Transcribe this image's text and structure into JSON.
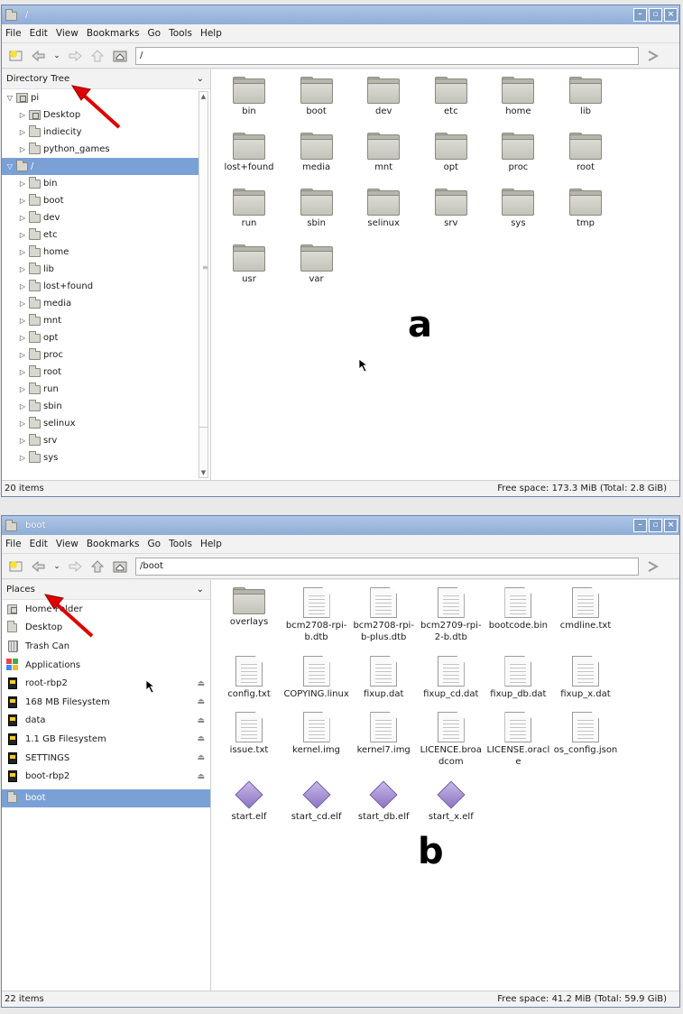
{
  "menu": [
    "File",
    "Edit",
    "View",
    "Bookmarks",
    "Go",
    "Tools",
    "Help"
  ],
  "window_a": {
    "title": "/",
    "path": "/",
    "side_title": "Directory Tree",
    "tree": [
      {
        "label": "pi",
        "level": 0,
        "open": true,
        "home": true,
        "selected": false
      },
      {
        "label": "Desktop",
        "level": 1,
        "open": false,
        "home": true,
        "selected": false
      },
      {
        "label": "indiecity",
        "level": 1,
        "open": false,
        "home": false,
        "selected": false
      },
      {
        "label": "python_games",
        "level": 1,
        "open": false,
        "home": false,
        "selected": false
      },
      {
        "label": "/",
        "level": 0,
        "open": true,
        "home": false,
        "selected": true
      },
      {
        "label": "bin",
        "level": 1,
        "open": false,
        "home": false,
        "selected": false
      },
      {
        "label": "boot",
        "level": 1,
        "open": false,
        "home": false,
        "selected": false
      },
      {
        "label": "dev",
        "level": 1,
        "open": false,
        "home": false,
        "selected": false
      },
      {
        "label": "etc",
        "level": 1,
        "open": false,
        "home": false,
        "selected": false
      },
      {
        "label": "home",
        "level": 1,
        "open": false,
        "home": false,
        "selected": false
      },
      {
        "label": "lib",
        "level": 1,
        "open": false,
        "home": false,
        "selected": false
      },
      {
        "label": "lost+found",
        "level": 1,
        "open": false,
        "home": false,
        "selected": false
      },
      {
        "label": "media",
        "level": 1,
        "open": false,
        "home": false,
        "selected": false
      },
      {
        "label": "mnt",
        "level": 1,
        "open": false,
        "home": false,
        "selected": false
      },
      {
        "label": "opt",
        "level": 1,
        "open": false,
        "home": false,
        "selected": false
      },
      {
        "label": "proc",
        "level": 1,
        "open": false,
        "home": false,
        "selected": false
      },
      {
        "label": "root",
        "level": 1,
        "open": false,
        "home": false,
        "selected": false
      },
      {
        "label": "run",
        "level": 1,
        "open": false,
        "home": false,
        "selected": false
      },
      {
        "label": "sbin",
        "level": 1,
        "open": false,
        "home": false,
        "selected": false
      },
      {
        "label": "selinux",
        "level": 1,
        "open": false,
        "home": false,
        "selected": false
      },
      {
        "label": "srv",
        "level": 1,
        "open": false,
        "home": false,
        "selected": false
      },
      {
        "label": "sys",
        "level": 1,
        "open": false,
        "home": false,
        "selected": false
      }
    ],
    "files": [
      {
        "name": "bin",
        "type": "folder"
      },
      {
        "name": "boot",
        "type": "folder"
      },
      {
        "name": "dev",
        "type": "folder"
      },
      {
        "name": "etc",
        "type": "folder"
      },
      {
        "name": "home",
        "type": "folder"
      },
      {
        "name": "lib",
        "type": "folder"
      },
      {
        "name": "lost+found",
        "type": "folder"
      },
      {
        "name": "media",
        "type": "folder"
      },
      {
        "name": "mnt",
        "type": "folder"
      },
      {
        "name": "opt",
        "type": "folder"
      },
      {
        "name": "proc",
        "type": "folder"
      },
      {
        "name": "root",
        "type": "folder"
      },
      {
        "name": "run",
        "type": "folder"
      },
      {
        "name": "sbin",
        "type": "folder"
      },
      {
        "name": "selinux",
        "type": "folder"
      },
      {
        "name": "srv",
        "type": "folder"
      },
      {
        "name": "sys",
        "type": "folder"
      },
      {
        "name": "tmp",
        "type": "folder"
      },
      {
        "name": "usr",
        "type": "folder"
      },
      {
        "name": "var",
        "type": "folder"
      }
    ],
    "status_items": "20 items",
    "status_free": "Free space: 173.3 MiB (Total: 2.8 GiB)",
    "panel_letter": "a"
  },
  "window_b": {
    "title": "boot",
    "path": "/boot",
    "side_title": "Places",
    "places": [
      {
        "label": "Home Folder",
        "icon": "home-folder-icon",
        "eject": false,
        "selected": false
      },
      {
        "label": "Desktop",
        "icon": "desktop-icon",
        "eject": false,
        "selected": false
      },
      {
        "label": "Trash Can",
        "icon": "trash-icon",
        "eject": false,
        "selected": false
      },
      {
        "label": "Applications",
        "icon": "applications-icon",
        "eject": false,
        "selected": false
      },
      {
        "label": "root-rbp2",
        "icon": "drive-icon",
        "eject": true,
        "selected": false
      },
      {
        "label": "168 MB Filesystem",
        "icon": "drive-icon",
        "eject": true,
        "selected": false
      },
      {
        "label": "data",
        "icon": "drive-icon",
        "eject": true,
        "selected": false
      },
      {
        "label": "1.1 GB Filesystem",
        "icon": "drive-icon",
        "eject": true,
        "selected": false
      },
      {
        "label": "SETTINGS",
        "icon": "drive-icon",
        "eject": true,
        "selected": false
      },
      {
        "label": "boot-rbp2",
        "icon": "drive-icon",
        "eject": true,
        "selected": false
      },
      {
        "label": "boot",
        "icon": "folder-icon",
        "eject": false,
        "selected": true
      }
    ],
    "files": [
      {
        "name": "overlays",
        "type": "folder"
      },
      {
        "name": "bcm2708-rpi-b.dtb",
        "type": "doc"
      },
      {
        "name": "bcm2708-rpi-b-plus.dtb",
        "type": "doc"
      },
      {
        "name": "bcm2709-rpi-2-b.dtb",
        "type": "doc"
      },
      {
        "name": "bootcode.bin",
        "type": "doc"
      },
      {
        "name": "cmdline.txt",
        "type": "doc"
      },
      {
        "name": "config.txt",
        "type": "doc"
      },
      {
        "name": "COPYING.linux",
        "type": "doc"
      },
      {
        "name": "fixup.dat",
        "type": "doc"
      },
      {
        "name": "fixup_cd.dat",
        "type": "doc"
      },
      {
        "name": "fixup_db.dat",
        "type": "doc"
      },
      {
        "name": "fixup_x.dat",
        "type": "doc"
      },
      {
        "name": "issue.txt",
        "type": "doc"
      },
      {
        "name": "kernel.img",
        "type": "doc"
      },
      {
        "name": "kernel7.img",
        "type": "doc"
      },
      {
        "name": "LICENCE.broadcom",
        "type": "doc"
      },
      {
        "name": "LICENSE.oracle",
        "type": "doc"
      },
      {
        "name": "os_config.json",
        "type": "doc"
      },
      {
        "name": "start.elf",
        "type": "elf"
      },
      {
        "name": "start_cd.elf",
        "type": "elf"
      },
      {
        "name": "start_db.elf",
        "type": "elf"
      },
      {
        "name": "start_x.elf",
        "type": "elf"
      }
    ],
    "status_items": "22 items",
    "status_free": "Free space: 41.2 MiB (Total: 59.9 GiB)",
    "panel_letter": "b"
  }
}
